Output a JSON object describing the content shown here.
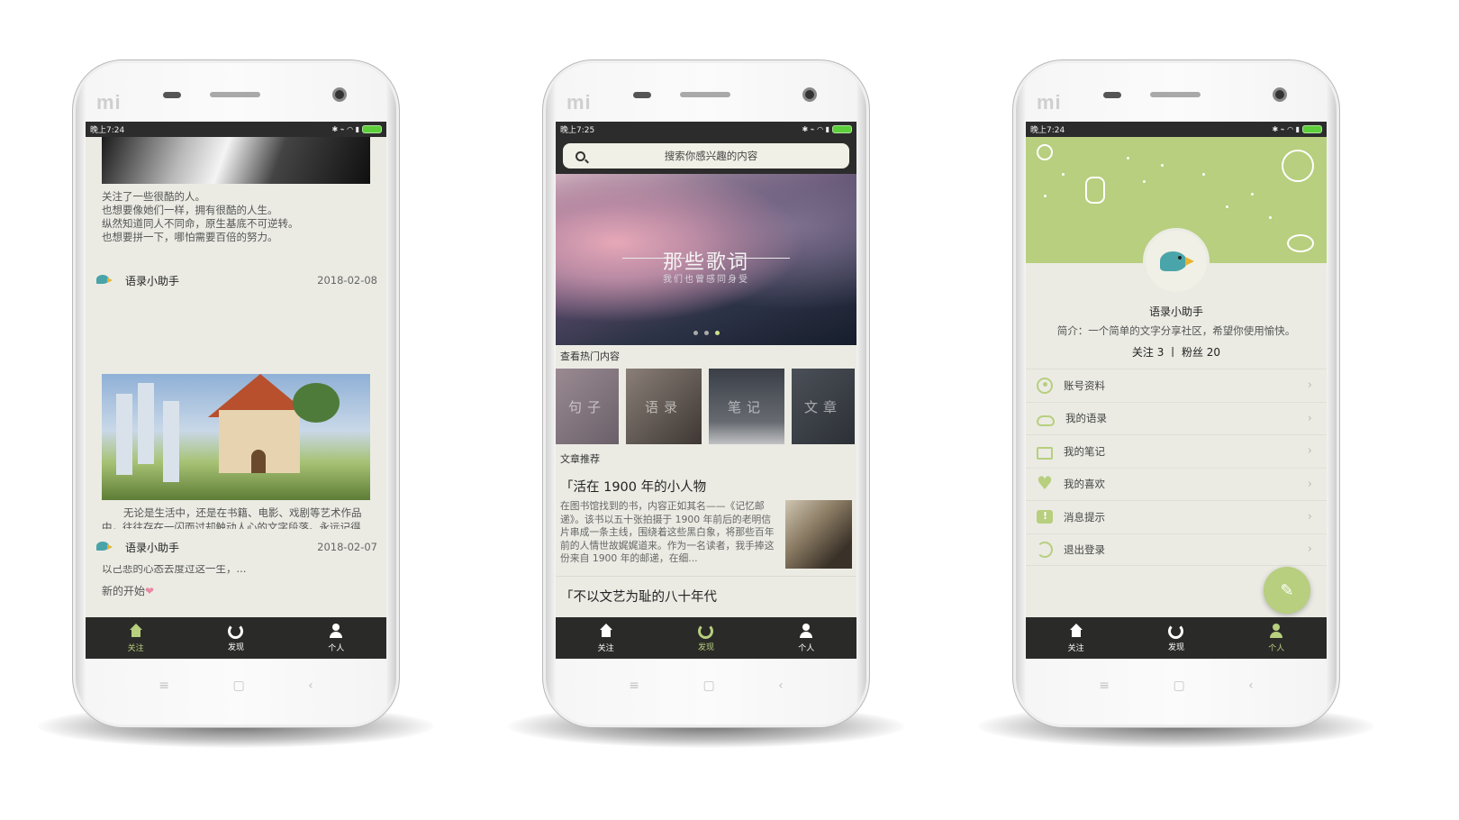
{
  "colors": {
    "accent": "#b7cf7e",
    "tabbar": "#2a2a28",
    "background": "#ebebe4"
  },
  "brand_logo": "mi",
  "phones": {
    "left": {
      "status_time": "晚上7:24",
      "quote_lines": [
        "关注了一些很酷的人。",
        "也想要像她们一样，拥有很酷的人生。",
        "纵然知道同人不同命，原生基底不可逆转。",
        "也想要拼一下，哪怕需要百倍的努力。"
      ],
      "post1": {
        "author": "语录小助手",
        "date": "2018-02-08",
        "text": "无论是生活中，还是在书籍、电影、戏剧等艺术作品中，往往存在一闪而过却触动人心的文字段落。永远记得《挪威的森林》里有这样一句话：“死并非生的对立面，而作为生的一部分永存”，它一直警戒着我要以一种平和、不以己悲的心态去度过这一生，..."
      },
      "post2": {
        "author": "语录小助手",
        "date": "2018-02-07",
        "text": "新的开始"
      }
    },
    "middle": {
      "status_time": "晚上7:25",
      "search_placeholder": "搜索你感兴趣的内容",
      "banner_title": "那些歌词",
      "banner_subtitle": "我们也曾感同身受",
      "hot_label": "查看热门内容",
      "hot_items": [
        "句子",
        "语录",
        "笔记",
        "文章"
      ],
      "article_label": "文章推荐",
      "articles": [
        {
          "title": "「活在 1900 年的小人物",
          "text": "在图书馆找到的书，内容正如其名——《记忆邮递》。该书以五十张拍摄于 1900 年前后的老明信片串成一条主线，围绕着这些黑白象，将那些百年前的人情世故娓娓道来。作为一名读者，我手捧这份来自 1900 年的邮递，在细..."
        },
        {
          "title": "「不以文艺为耻的八十年代",
          "text": ""
        }
      ]
    },
    "right": {
      "status_time": "晚上7:24",
      "profile_name": "语录小助手",
      "profile_intro": "简介：一个简单的文字分享社区，希望你使用愉快。",
      "profile_stats": "关注 3 丨 粉丝 20",
      "menu": [
        {
          "label": "账号资料",
          "icon": "user-circle-icon"
        },
        {
          "label": "我的语录",
          "icon": "cloud-icon"
        },
        {
          "label": "我的笔记",
          "icon": "book-icon"
        },
        {
          "label": "我的喜欢",
          "icon": "heart-icon"
        },
        {
          "label": "消息提示",
          "icon": "message-icon"
        },
        {
          "label": "退出登录",
          "icon": "logout-icon"
        }
      ],
      "fab_icon": "pencil-icon"
    }
  },
  "tabs": [
    {
      "label": "关注",
      "icon": "home-icon"
    },
    {
      "label": "发现",
      "icon": "discover-icon"
    },
    {
      "label": "个人",
      "icon": "user-icon"
    }
  ],
  "active_tabs": {
    "left": "关注",
    "middle": "发现",
    "right": "个人"
  }
}
